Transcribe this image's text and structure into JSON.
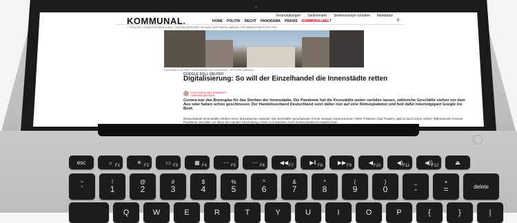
{
  "site": {
    "logo": "KOMMUNAL",
    "logo_dot": ".",
    "topnav": [
      "Veranstaltungen",
      "Stellenmarkt",
      "Stellenanzeige schalten",
      "Marktplatz"
    ],
    "mainnav": [
      "HOME",
      "POLITIK",
      "RECHT",
      "PANORAMA",
      "PRAXIS",
      "KOMMUNALWELT"
    ],
    "breadcrumb": "⌂ / POLITIK / STADTENTWICKLUNG / DIGITALISIERUNG: SO WILL DER EINZELHANDEL DIE INNENSTÄDTE RETTEN",
    "caption": "Innenstädte in der Krise: Einkaufsstraßen ohne Kundschaft – hier in einer Mittelstadt",
    "kicker": "GOOGLE SOLL HELFEN",
    "headline": "Digitalisierung: So will der Einzelhandel die Innenstädte retten",
    "author": "VON CHRISTIAN ERHARDT",
    "author_sub": "CHEFREDAKTEUR",
    "lead": "Corona war das Brennglas für das Sterben der Innenstädte. Die Pandemie hat die Kernstädte weiter veröden lassen, zahlreiche Geschäfte stehen vor dem Aus oder haben schon geschlossen. Der Handelsverband Deutschland setzt daher nun auf eine Rettungsaktion und holt dafür Internetgigant Google ins Boot.",
    "body": "Deutschlands Innenstädte erleben einen dramatischen Wandel. Die Geschäfte verschwinden immer weniger Leute kommen. Mehr Tristesse. Das Problem gab es auch schon vorher. Während der Corona-Pandemie sind aber vor allem der Handel mit Kleidung, Uhren und Büchern noch einmal drastisch eingebrochen."
  },
  "keyboard": {
    "fn_row": [
      {
        "label": "esc",
        "sub": ""
      },
      {
        "label": "☼",
        "sub": "F1"
      },
      {
        "label": "☀",
        "sub": "F2"
      },
      {
        "label": "▭",
        "sub": "F3"
      },
      {
        "label": "▦",
        "sub": "F4"
      },
      {
        "label": "⋯",
        "sub": "F5"
      },
      {
        "label": "⋯",
        "sub": "F6"
      },
      {
        "label": "◀◀",
        "sub": "F7"
      },
      {
        "label": "▶‖",
        "sub": "F8"
      },
      {
        "label": "▶▶",
        "sub": "F9"
      },
      {
        "label": "◀",
        "sub": "F10"
      },
      {
        "label": "◀)",
        "sub": "F11"
      },
      {
        "label": "◀))",
        "sub": "F12"
      },
      {
        "label": "⏏",
        "sub": ""
      }
    ],
    "num_row": [
      {
        "top": "~",
        "bot": "`"
      },
      {
        "top": "!",
        "bot": "1"
      },
      {
        "top": "@",
        "bot": "2"
      },
      {
        "top": "#",
        "bot": "3"
      },
      {
        "top": "$",
        "bot": "4"
      },
      {
        "top": "%",
        "bot": "5"
      },
      {
        "top": "^",
        "bot": "6"
      },
      {
        "top": "&",
        "bot": "7"
      },
      {
        "top": "*",
        "bot": "8"
      },
      {
        "top": "(",
        "bot": "9"
      },
      {
        "top": ")",
        "bot": "0"
      },
      {
        "top": "_",
        "bot": "-"
      },
      {
        "top": "+",
        "bot": "="
      },
      {
        "top": "",
        "bot": "delete"
      }
    ],
    "letter_row": [
      "",
      "Q",
      "W",
      "E",
      "R",
      "T",
      "Y",
      "U",
      "I",
      "O",
      "P",
      "{",
      "}",
      "|"
    ]
  }
}
